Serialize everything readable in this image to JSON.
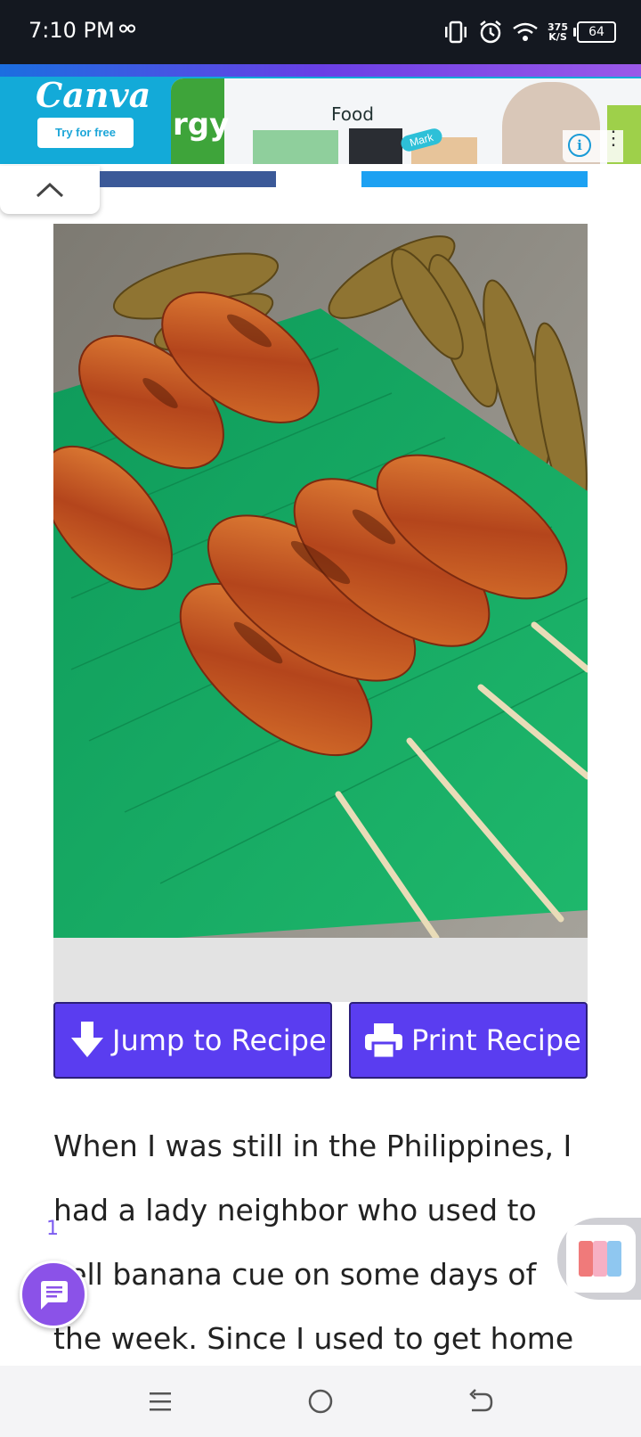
{
  "status_bar": {
    "time": "7:10 PM",
    "net_speed_value": "375",
    "net_speed_unit": "K/S",
    "battery": "64",
    "icons": [
      "incognito-glasses-icon",
      "vibrate-icon",
      "alarm-icon",
      "wifi-icon"
    ]
  },
  "ad": {
    "brand": "Canva",
    "cta": "Try for free",
    "visual_text": "Food",
    "fragment_text": "rgy",
    "badge_text": "Mark"
  },
  "hero": {
    "image": "grilled banana cue skewers on banana leaf"
  },
  "buttons": {
    "jump_label": "Jump to Recipe",
    "print_label": "Print Recipe"
  },
  "article": {
    "lines": [
      "When I was still in the Philippines, I",
      "had a lady neighbor who used to",
      "sell banana cue on some days of",
      "the week. Since I used to get home"
    ]
  },
  "footnote": "1",
  "colors": {
    "button": "#5a3df0",
    "ad_background": "#13aad8",
    "facebook": "#3b5998",
    "twitter": "#1da1f2",
    "chat_fab": "#8b52e8"
  }
}
